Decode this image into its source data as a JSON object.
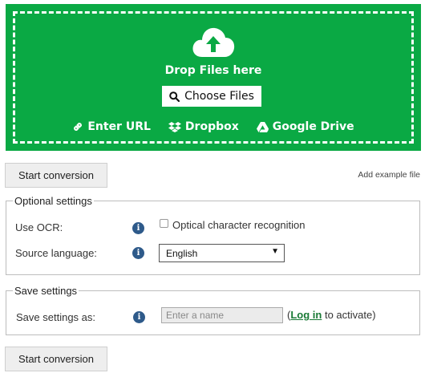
{
  "dropzone": {
    "drop_text": "Drop Files here",
    "choose_label": "Choose Files",
    "sources": [
      {
        "label": "Enter URL",
        "icon": "link-icon"
      },
      {
        "label": "Dropbox",
        "icon": "dropbox-icon"
      },
      {
        "label": "Google Drive",
        "icon": "google-drive-icon"
      }
    ],
    "bg_color": "#0aa944"
  },
  "toolbar": {
    "start_label": "Start conversion",
    "example_label": "Add example file"
  },
  "optional_settings": {
    "legend": "Optional settings",
    "ocr_label": "Use OCR:",
    "ocr_checkbox_label": "Optical character recognition",
    "ocr_checked": false,
    "source_language_label": "Source language:",
    "source_language_value": "English"
  },
  "save_settings": {
    "legend": "Save settings",
    "label": "Save settings as:",
    "name_placeholder": "Enter a name",
    "login_prefix": "(",
    "login_link": "Log in",
    "login_suffix": " to activate)"
  },
  "footer": {
    "start_label": "Start conversion"
  }
}
